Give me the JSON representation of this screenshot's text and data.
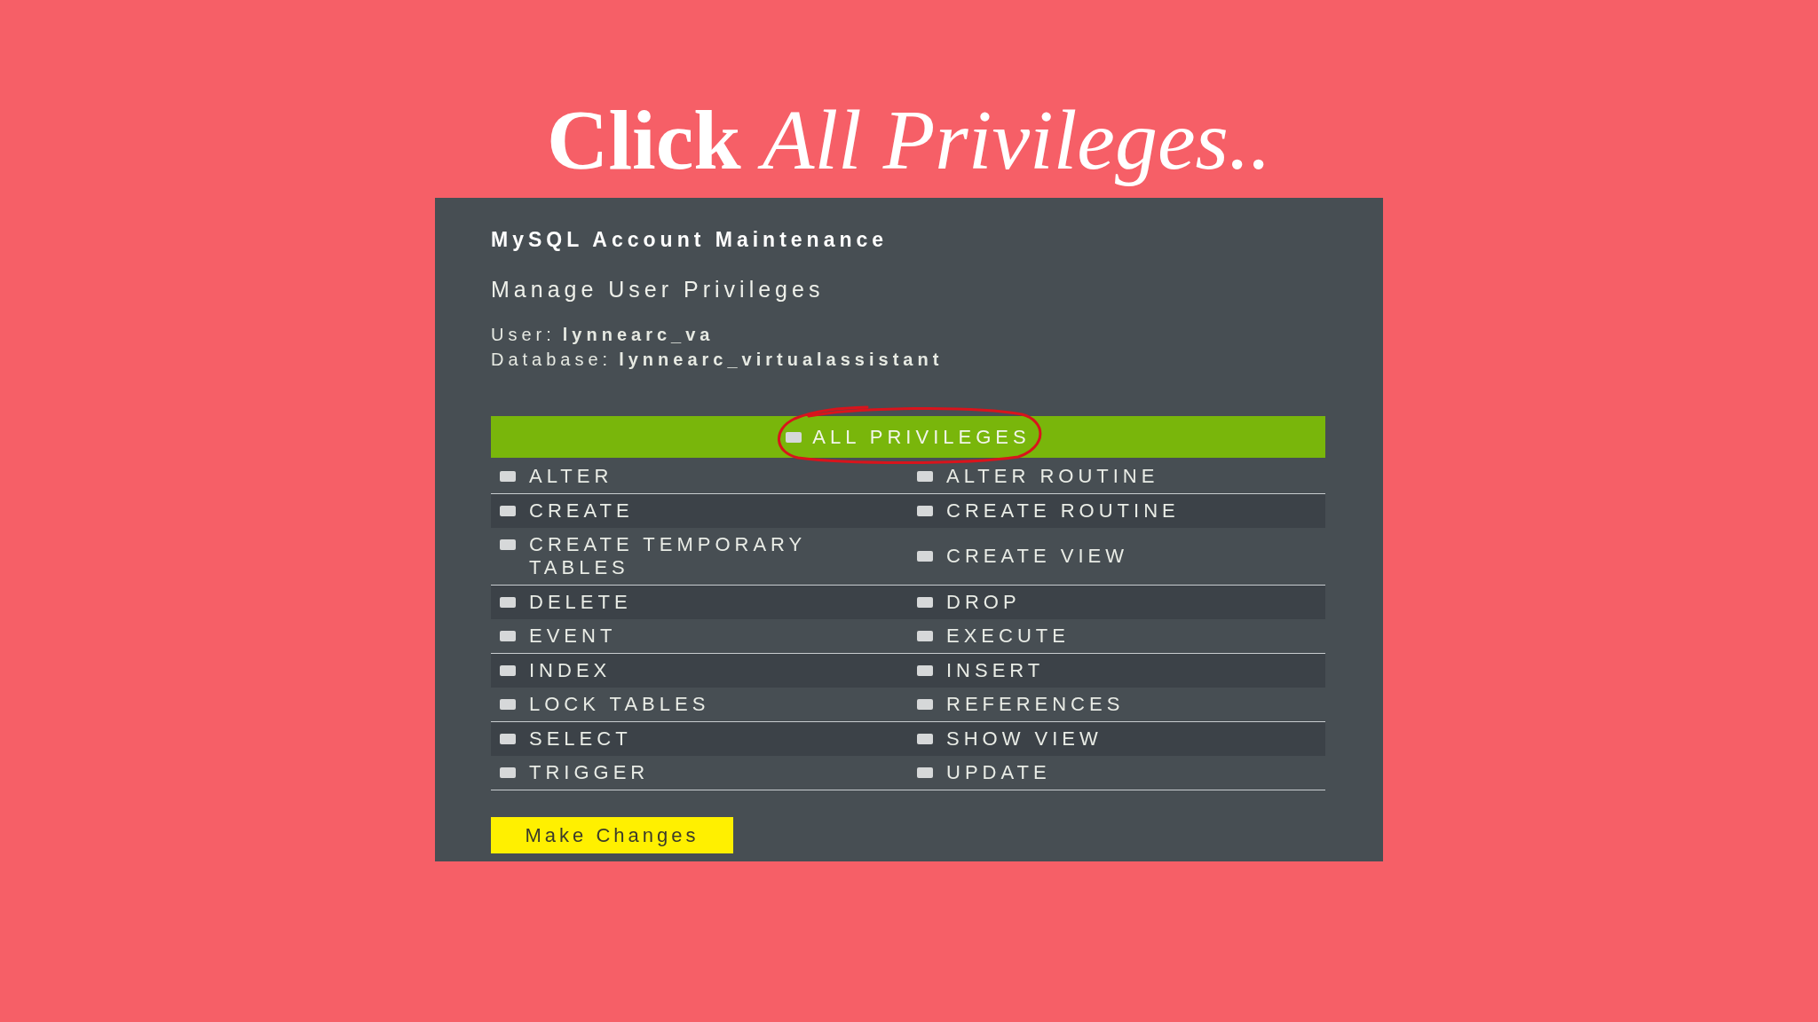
{
  "title": "**Click** *All Privileges..*",
  "panel": {
    "heading": "MySQL Account Maintenance",
    "subheading": "Manage User Privileges",
    "details": [
      {
        "label": "User:",
        "value": "lynnearc_va"
      },
      {
        "label": "Database:",
        "value": "lynnearc_virtualassistant"
      }
    ],
    "all_privileges": {
      "label": "ALL PRIVILEGES",
      "checked": false,
      "circled": true
    },
    "privileges": [
      {
        "cells": [
          {
            "label": "ALTER",
            "checked": false
          },
          {
            "label": "ALTER ROUTINE",
            "checked": false
          }
        ]
      },
      {
        "cells": [
          {
            "label": "CREATE",
            "checked": false
          },
          {
            "label": "CREATE ROUTINE",
            "checked": false
          }
        ]
      },
      {
        "cells": [
          {
            "label": "CREATE TEMPORARY TABLES",
            "checked": false
          },
          {
            "label": "CREATE VIEW",
            "checked": false
          }
        ]
      },
      {
        "cells": [
          {
            "label": "DELETE",
            "checked": false
          },
          {
            "label": "DROP",
            "checked": false
          }
        ]
      },
      {
        "cells": [
          {
            "label": "EVENT",
            "checked": false
          },
          {
            "label": "EXECUTE",
            "checked": false
          }
        ]
      },
      {
        "cells": [
          {
            "label": "INDEX",
            "checked": false
          },
          {
            "label": "INSERT",
            "checked": false
          }
        ]
      },
      {
        "cells": [
          {
            "label": "LOCK TABLES",
            "checked": false
          },
          {
            "label": "REFERENCES",
            "checked": false
          }
        ]
      },
      {
        "cells": [
          {
            "label": "SELECT",
            "checked": false
          },
          {
            "label": "SHOW VIEW",
            "checked": false
          }
        ]
      },
      {
        "cells": [
          {
            "label": "TRIGGER",
            "checked": false
          },
          {
            "label": "UPDATE",
            "checked": false
          }
        ]
      }
    ],
    "button": {
      "label": "Make Changes"
    }
  }
}
